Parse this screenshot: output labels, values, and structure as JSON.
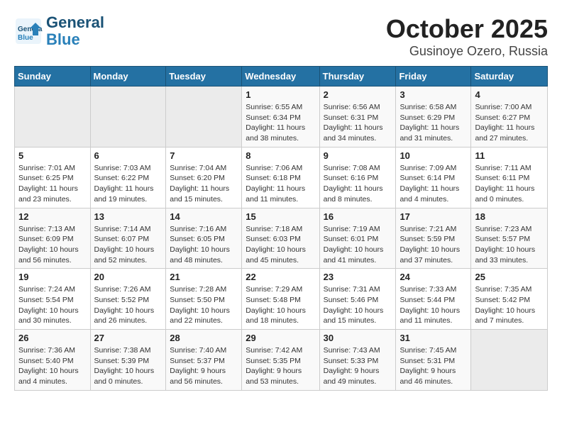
{
  "header": {
    "logo_line1": "General",
    "logo_line2": "Blue",
    "month": "October 2025",
    "location": "Gusinoye Ozero, Russia"
  },
  "weekdays": [
    "Sunday",
    "Monday",
    "Tuesday",
    "Wednesday",
    "Thursday",
    "Friday",
    "Saturday"
  ],
  "weeks": [
    [
      {
        "day": "",
        "info": ""
      },
      {
        "day": "",
        "info": ""
      },
      {
        "day": "",
        "info": ""
      },
      {
        "day": "1",
        "info": "Sunrise: 6:55 AM\nSunset: 6:34 PM\nDaylight: 11 hours\nand 38 minutes."
      },
      {
        "day": "2",
        "info": "Sunrise: 6:56 AM\nSunset: 6:31 PM\nDaylight: 11 hours\nand 34 minutes."
      },
      {
        "day": "3",
        "info": "Sunrise: 6:58 AM\nSunset: 6:29 PM\nDaylight: 11 hours\nand 31 minutes."
      },
      {
        "day": "4",
        "info": "Sunrise: 7:00 AM\nSunset: 6:27 PM\nDaylight: 11 hours\nand 27 minutes."
      }
    ],
    [
      {
        "day": "5",
        "info": "Sunrise: 7:01 AM\nSunset: 6:25 PM\nDaylight: 11 hours\nand 23 minutes."
      },
      {
        "day": "6",
        "info": "Sunrise: 7:03 AM\nSunset: 6:22 PM\nDaylight: 11 hours\nand 19 minutes."
      },
      {
        "day": "7",
        "info": "Sunrise: 7:04 AM\nSunset: 6:20 PM\nDaylight: 11 hours\nand 15 minutes."
      },
      {
        "day": "8",
        "info": "Sunrise: 7:06 AM\nSunset: 6:18 PM\nDaylight: 11 hours\nand 11 minutes."
      },
      {
        "day": "9",
        "info": "Sunrise: 7:08 AM\nSunset: 6:16 PM\nDaylight: 11 hours\nand 8 minutes."
      },
      {
        "day": "10",
        "info": "Sunrise: 7:09 AM\nSunset: 6:14 PM\nDaylight: 11 hours\nand 4 minutes."
      },
      {
        "day": "11",
        "info": "Sunrise: 7:11 AM\nSunset: 6:11 PM\nDaylight: 11 hours\nand 0 minutes."
      }
    ],
    [
      {
        "day": "12",
        "info": "Sunrise: 7:13 AM\nSunset: 6:09 PM\nDaylight: 10 hours\nand 56 minutes."
      },
      {
        "day": "13",
        "info": "Sunrise: 7:14 AM\nSunset: 6:07 PM\nDaylight: 10 hours\nand 52 minutes."
      },
      {
        "day": "14",
        "info": "Sunrise: 7:16 AM\nSunset: 6:05 PM\nDaylight: 10 hours\nand 48 minutes."
      },
      {
        "day": "15",
        "info": "Sunrise: 7:18 AM\nSunset: 6:03 PM\nDaylight: 10 hours\nand 45 minutes."
      },
      {
        "day": "16",
        "info": "Sunrise: 7:19 AM\nSunset: 6:01 PM\nDaylight: 10 hours\nand 41 minutes."
      },
      {
        "day": "17",
        "info": "Sunrise: 7:21 AM\nSunset: 5:59 PM\nDaylight: 10 hours\nand 37 minutes."
      },
      {
        "day": "18",
        "info": "Sunrise: 7:23 AM\nSunset: 5:57 PM\nDaylight: 10 hours\nand 33 minutes."
      }
    ],
    [
      {
        "day": "19",
        "info": "Sunrise: 7:24 AM\nSunset: 5:54 PM\nDaylight: 10 hours\nand 30 minutes."
      },
      {
        "day": "20",
        "info": "Sunrise: 7:26 AM\nSunset: 5:52 PM\nDaylight: 10 hours\nand 26 minutes."
      },
      {
        "day": "21",
        "info": "Sunrise: 7:28 AM\nSunset: 5:50 PM\nDaylight: 10 hours\nand 22 minutes."
      },
      {
        "day": "22",
        "info": "Sunrise: 7:29 AM\nSunset: 5:48 PM\nDaylight: 10 hours\nand 18 minutes."
      },
      {
        "day": "23",
        "info": "Sunrise: 7:31 AM\nSunset: 5:46 PM\nDaylight: 10 hours\nand 15 minutes."
      },
      {
        "day": "24",
        "info": "Sunrise: 7:33 AM\nSunset: 5:44 PM\nDaylight: 10 hours\nand 11 minutes."
      },
      {
        "day": "25",
        "info": "Sunrise: 7:35 AM\nSunset: 5:42 PM\nDaylight: 10 hours\nand 7 minutes."
      }
    ],
    [
      {
        "day": "26",
        "info": "Sunrise: 7:36 AM\nSunset: 5:40 PM\nDaylight: 10 hours\nand 4 minutes."
      },
      {
        "day": "27",
        "info": "Sunrise: 7:38 AM\nSunset: 5:39 PM\nDaylight: 10 hours\nand 0 minutes."
      },
      {
        "day": "28",
        "info": "Sunrise: 7:40 AM\nSunset: 5:37 PM\nDaylight: 9 hours\nand 56 minutes."
      },
      {
        "day": "29",
        "info": "Sunrise: 7:42 AM\nSunset: 5:35 PM\nDaylight: 9 hours\nand 53 minutes."
      },
      {
        "day": "30",
        "info": "Sunrise: 7:43 AM\nSunset: 5:33 PM\nDaylight: 9 hours\nand 49 minutes."
      },
      {
        "day": "31",
        "info": "Sunrise: 7:45 AM\nSunset: 5:31 PM\nDaylight: 9 hours\nand 46 minutes."
      },
      {
        "day": "",
        "info": ""
      }
    ]
  ]
}
